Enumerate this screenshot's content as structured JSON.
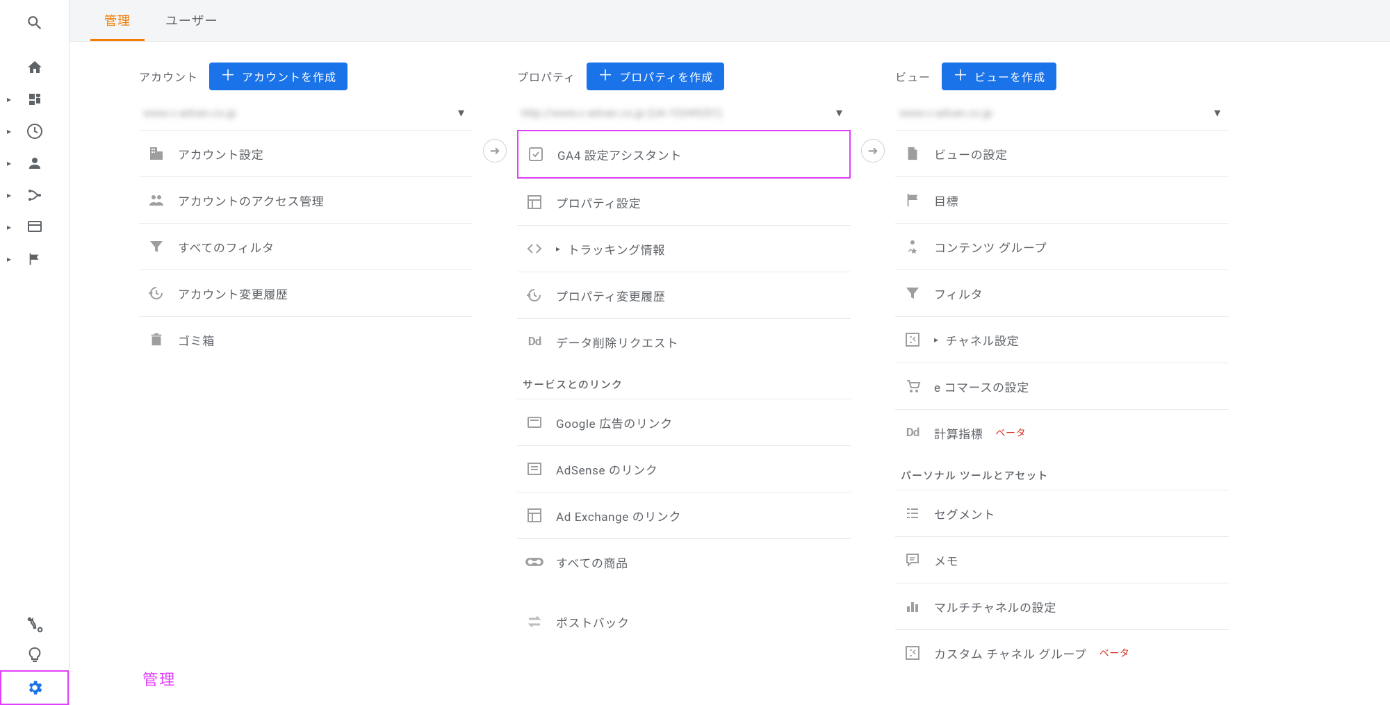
{
  "tabs": {
    "admin": "管理",
    "user": "ユーザー"
  },
  "admin_label": "管理",
  "columns": {
    "account": {
      "title": "アカウント",
      "create_btn": "アカウントを作成",
      "selector": "www.c-advan.co.jp",
      "items": {
        "settings": "アカウント設定",
        "access": "アカウントのアクセス管理",
        "filters": "すべてのフィルタ",
        "history": "アカウント変更履歴",
        "trash": "ゴミ箱"
      }
    },
    "property": {
      "title": "プロパティ",
      "create_btn": "プロパティを作成",
      "selector": "http://www.c-advan.co.jp (UA-10349201)",
      "items": {
        "ga4": "GA4 設定アシスタント",
        "settings": "プロパティ設定",
        "tracking": "トラッキング情報",
        "history": "プロパティ変更履歴",
        "data_delete": "データ削除リクエスト"
      },
      "service_link_title": "サービスとのリンク",
      "links": {
        "gads": "Google 広告のリンク",
        "adsense": "AdSense のリンク",
        "adx": "Ad Exchange のリンク",
        "all_products": "すべての商品",
        "postback": "ポストバック"
      }
    },
    "view": {
      "title": "ビュー",
      "create_btn": "ビューを作成",
      "selector": "www.c-advan.co.jp",
      "items": {
        "settings": "ビューの設定",
        "goals": "目標",
        "content_groups": "コンテンツ グループ",
        "filters": "フィルタ",
        "channel": "チャネル設定",
        "ecommerce": "e コマースの設定",
        "calc_metrics": "計算指標",
        "beta1": "ベータ"
      },
      "personal_title": "パーソナル ツールとアセット",
      "personal": {
        "segments": "セグメント",
        "memo": "メモ",
        "multichannel": "マルチチャネルの設定",
        "custom_channel": "カスタム チャネル グループ",
        "beta2": "ベータ"
      }
    }
  }
}
